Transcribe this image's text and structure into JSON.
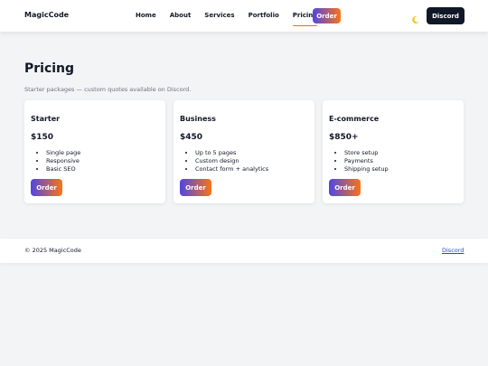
{
  "corner_link": "c",
  "header": {
    "logo": "MagicCode",
    "nav": [
      {
        "label": "Home",
        "active": false
      },
      {
        "label": "About",
        "active": false
      },
      {
        "label": "Services",
        "active": false
      },
      {
        "label": "Portfolio",
        "active": false
      },
      {
        "label": "Pricing",
        "active": true
      }
    ],
    "order_label": "Order",
    "discord_label": "Discord"
  },
  "main": {
    "title": "Pricing",
    "subtitle": "Starter packages — custom quotes available on Discord."
  },
  "plans": [
    {
      "name": "Starter",
      "price": "$150",
      "features": [
        "Single page",
        "Responsive",
        "Basic SEO"
      ],
      "button": "Order"
    },
    {
      "name": "Business",
      "price": "$450",
      "features": [
        "Up to 5 pages",
        "Custom design",
        "Contact form + analytics"
      ],
      "button": "Order"
    },
    {
      "name": "E-commerce",
      "price": "$850+",
      "features": [
        "Store setup",
        "Payments",
        "Shipping setup"
      ],
      "button": "Order"
    }
  ],
  "footer": {
    "copyright": "© 2025 MagicCode",
    "discord_link": "Discord"
  },
  "colors": {
    "accent_gradient_start": "#4f46e5",
    "accent_gradient_end": "#f97316",
    "active_underline": "#d97706",
    "dark_button": "#111827",
    "background": "#f3f4f6"
  },
  "icons": {
    "theme_toggle": "moon-icon"
  }
}
